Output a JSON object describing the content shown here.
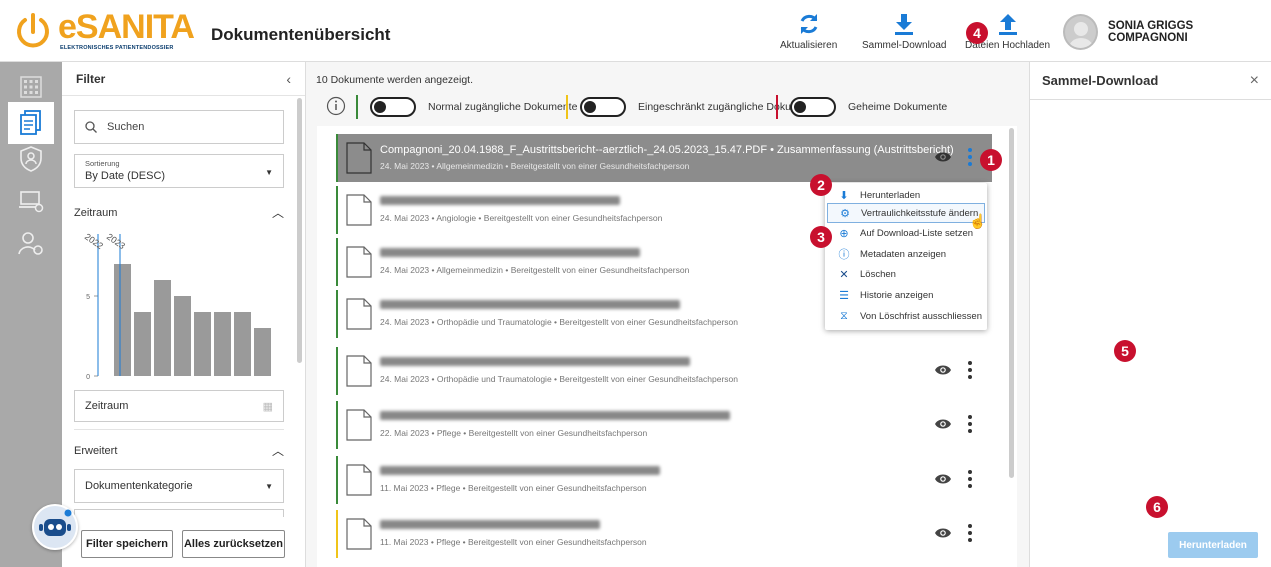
{
  "header": {
    "logo_text": "eSANITA",
    "logo_sub": "ELEKTRONISCHES PATIENTENDOSSIER",
    "title": "Dokumentenübersicht",
    "actions": {
      "refresh": "Aktualisieren",
      "bulk_download": "Sammel-Download",
      "upload": "Dateien Hochladen"
    },
    "user": "SONIA GRIGGS COMPAGNONI"
  },
  "filter": {
    "title": "Filter",
    "search_placeholder": "Suchen",
    "sort_label": "Sortierung",
    "sort_value": "By Date (DESC)",
    "period_heading": "Zeitraum",
    "period_field": "Zeitraum",
    "advanced_heading": "Erweitert",
    "category_field": "Dokumentenkategorie",
    "save_button": "Filter speichern",
    "reset_button": "Alles zurücksetzen"
  },
  "chart_data": {
    "type": "bar",
    "categories": [
      "2023",
      "",
      "",
      "",
      "",
      "",
      "",
      ""
    ],
    "values": [
      7,
      4,
      6,
      5,
      4,
      4,
      4,
      3
    ],
    "year_labels": [
      "2022",
      "2023"
    ],
    "ylim": [
      0,
      8
    ],
    "yticks": [
      "0",
      "5"
    ],
    "grid": false,
    "bar_color": "#9a9a9a"
  },
  "main": {
    "count_text": "10 Dokumente werden angezeigt.",
    "legend": [
      {
        "label": "Normal zugängliche Dokumente",
        "color": "#3a8a3a"
      },
      {
        "label": "Eingeschränkt zugängliche Dokumente",
        "color": "#f0c419"
      },
      {
        "label": "Geheime Dokumente",
        "color": "#c8102e"
      }
    ],
    "documents": [
      {
        "title": "Compagnoni_20.04.1988_F_Austrittsbericht--aerztlich-_24.05.2023_15.47.PDF • Zusammenfassung (Austrittsbericht)",
        "meta": "24. Mai 2023 • Allgemeinmedizin • Bereitgestellt von einer Gesundheitsfachperson",
        "color": "#3a8a3a"
      },
      {
        "title": "",
        "meta": "24. Mai 2023 • Angiologie • Bereitgestellt von einer Gesundheitsfachperson",
        "color": "#3a8a3a"
      },
      {
        "title": "",
        "meta": "24. Mai 2023 • Allgemeinmedizin • Bereitgestellt von einer Gesundheitsfachperson",
        "color": "#3a8a3a"
      },
      {
        "title": "",
        "meta": "24. Mai 2023 • Orthopädie und Traumatologie • Bereitgestellt von einer Gesundheitsfachperson",
        "color": "#3a8a3a"
      },
      {
        "title": "",
        "meta": "24. Mai 2023 • Orthopädie und Traumatologie • Bereitgestellt von einer Gesundheitsfachperson",
        "color": "#3a8a3a"
      },
      {
        "title": "",
        "meta": "22. Mai 2023 • Pflege • Bereitgestellt von einer Gesundheitsfachperson",
        "color": "#3a8a3a"
      },
      {
        "title": "",
        "meta": "11. Mai 2023 • Pflege • Bereitgestellt von einer Gesundheitsfachperson",
        "color": "#3a8a3a"
      },
      {
        "title": "",
        "meta": "11. Mai 2023 • Pflege • Bereitgestellt von einer Gesundheitsfachperson",
        "color": "#f0c419"
      }
    ]
  },
  "context_menu": [
    {
      "label": "Herunterladen",
      "icon": "download-icon"
    },
    {
      "label": "Vertraulichkeitsstufe ändern",
      "icon": "confidentiality-icon"
    },
    {
      "label": "Auf Download-Liste setzen",
      "icon": "plus-circle-icon"
    },
    {
      "label": "Metadaten anzeigen",
      "icon": "info-icon"
    },
    {
      "label": "Löschen",
      "icon": "delete-icon"
    },
    {
      "label": "Historie anzeigen",
      "icon": "history-icon"
    },
    {
      "label": "Von Löschfrist ausschliessen",
      "icon": "exclude-icon"
    }
  ],
  "sidepanel": {
    "title": "Sammel-Download",
    "download_button": "Herunterladen"
  },
  "badges": [
    "1",
    "2",
    "3",
    "4",
    "5",
    "6"
  ]
}
